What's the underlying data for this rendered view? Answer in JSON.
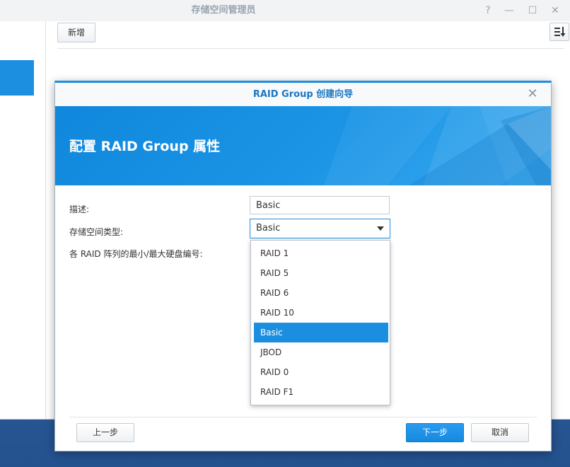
{
  "app": {
    "title": "存储空间管理员",
    "help_icon": "?",
    "minimize_icon": "—",
    "maximize_icon": "☐",
    "close_icon": "✕",
    "toolbar": {
      "new_label": "新增"
    }
  },
  "wizard": {
    "title": "RAID Group 创建向导",
    "close_icon": "✕",
    "banner_title": "配置 RAID Group 属性",
    "fields": {
      "description_label": "描述:",
      "description_value": "Basic",
      "storage_type_label": "存储空间类型:",
      "storage_type_value": "Basic",
      "disk_count_label": "各 RAID 阵列的最小/最大硬盘编号:"
    },
    "dropdown_options": [
      "RAID 1",
      "RAID 5",
      "RAID 6",
      "RAID 10",
      "Basic",
      "JBOD",
      "RAID 0",
      "RAID F1"
    ],
    "selected_option": "Basic",
    "buttons": {
      "back": "上一步",
      "next": "下一步",
      "cancel": "取消"
    }
  },
  "colors": {
    "accent": "#1c8ee0",
    "banner": "#1c95e6",
    "desktop": "#2d5a92"
  }
}
